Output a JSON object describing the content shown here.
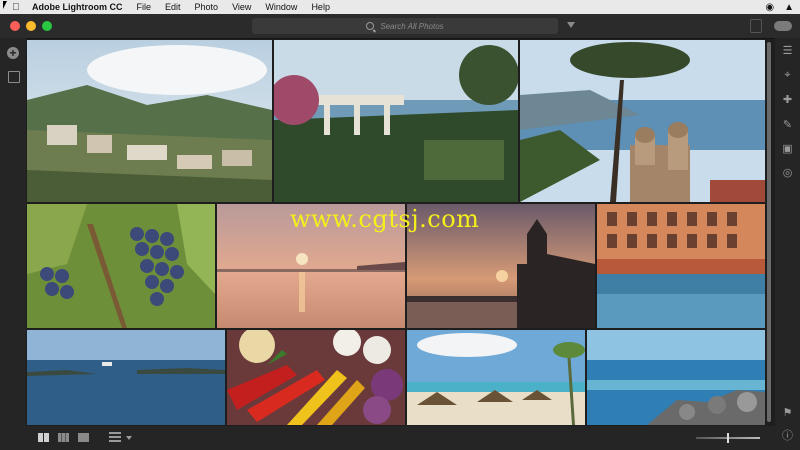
{
  "menubar": {
    "app_name": "Adobe Lightroom CC",
    "items": [
      "File",
      "Edit",
      "Photo",
      "View",
      "Window",
      "Help"
    ]
  },
  "search": {
    "placeholder": "Search All Photos"
  },
  "watermark": "www.cgtsj.com",
  "zoom": {
    "level_fraction": 0.5
  },
  "icons": {
    "left": [
      "add-photos-icon",
      "library-icon"
    ],
    "right": [
      "edit-sliders-icon",
      "crop-icon",
      "healing-icon",
      "brush-icon",
      "linear-gradient-icon",
      "radial-gradient-icon",
      "keywords-icon",
      "info-icon"
    ],
    "bottom": [
      "square-grid-icon",
      "photo-grid-icon",
      "detail-view-icon",
      "sort-icon"
    ]
  },
  "colors": {
    "window_bg": "#1e1e1e",
    "toolbar_bg": "#252525",
    "accent_watermark": "#f5f01a"
  }
}
